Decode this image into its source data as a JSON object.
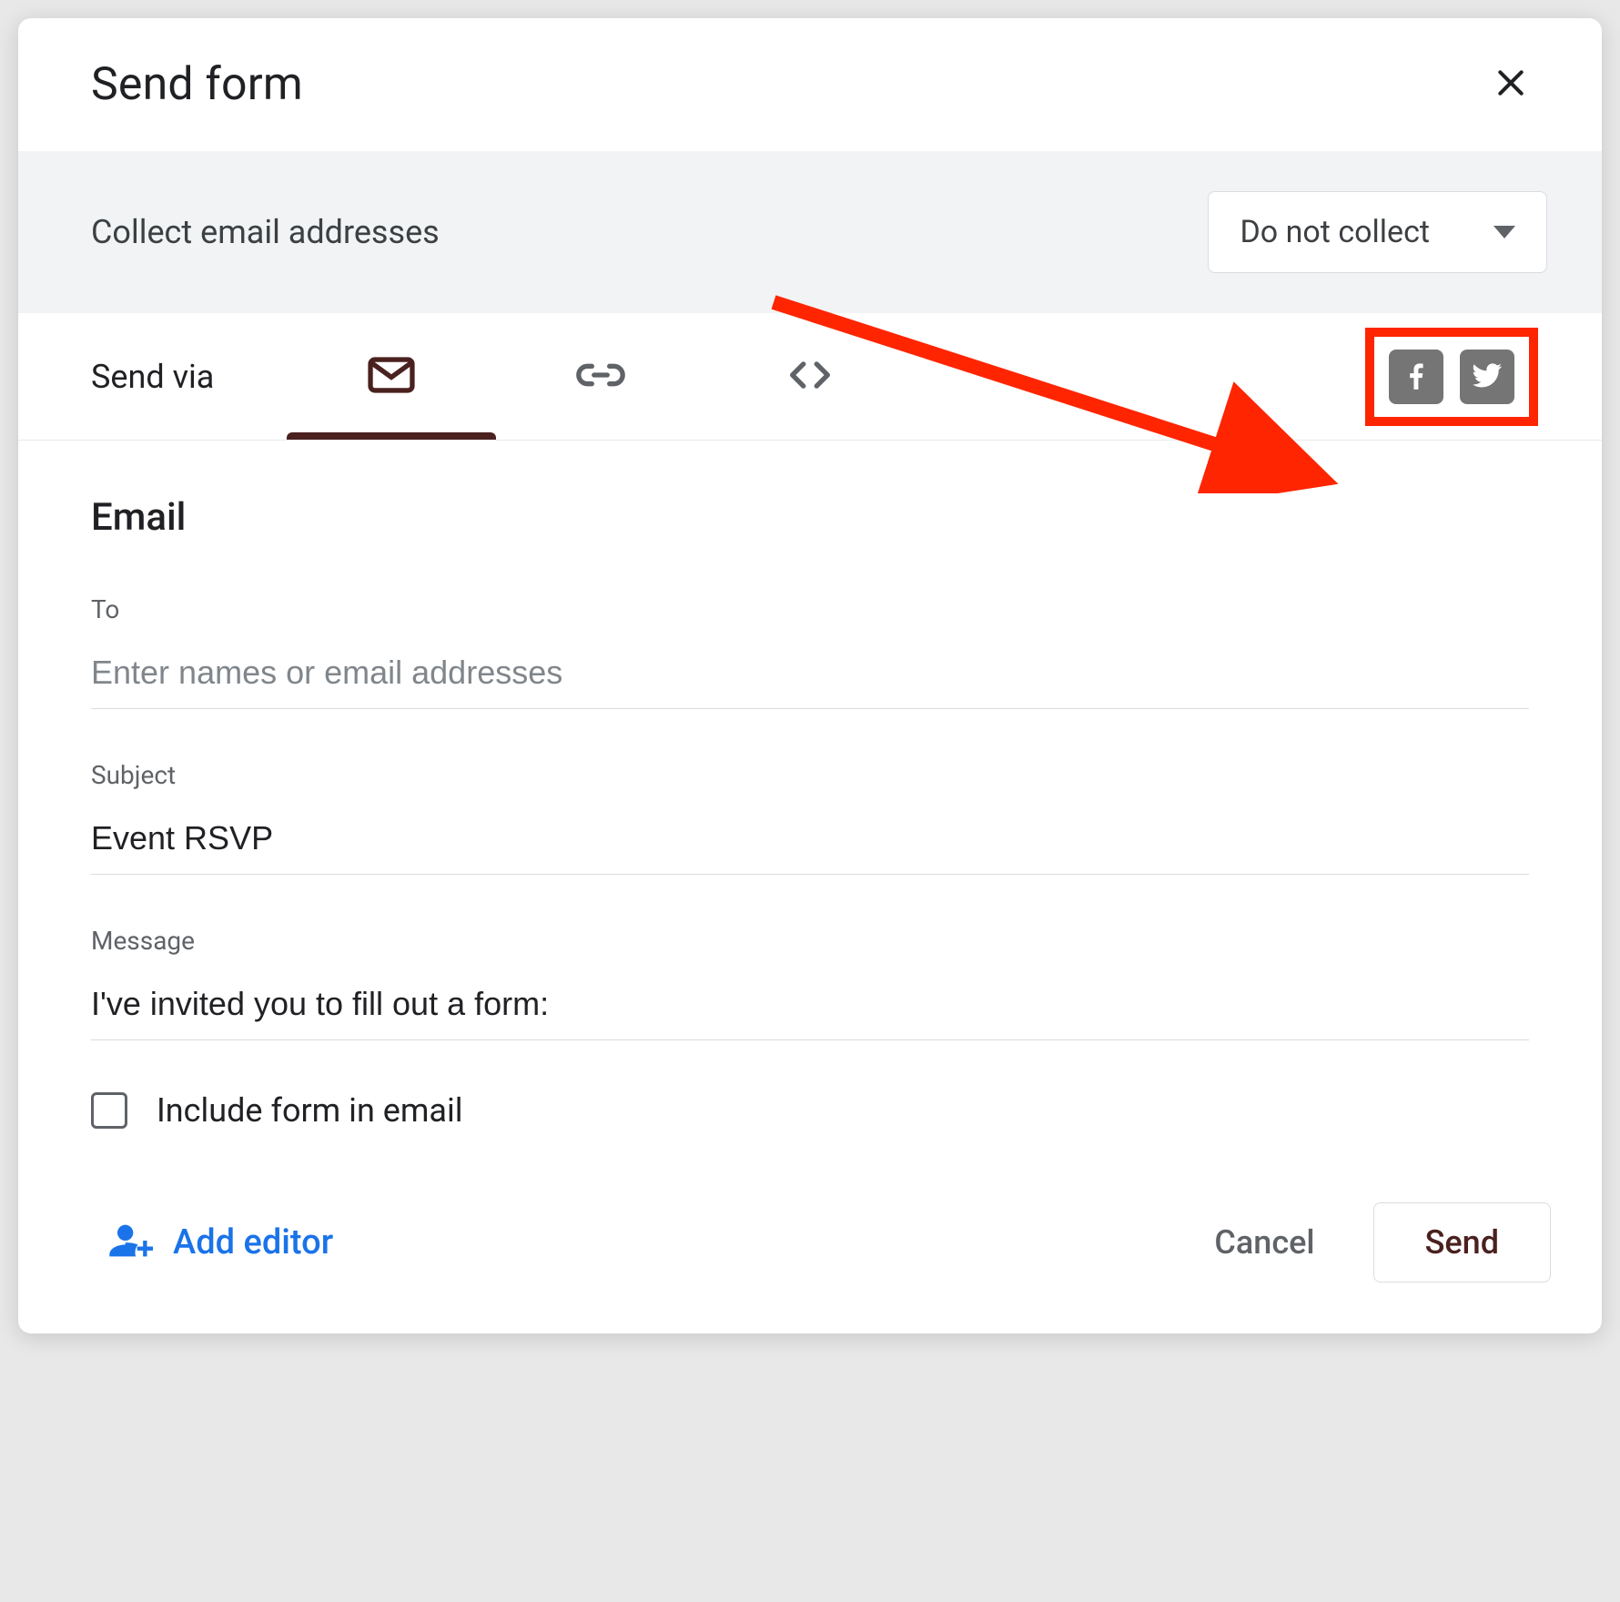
{
  "dialog": {
    "title": "Send form"
  },
  "collect": {
    "label": "Collect email addresses",
    "selected": "Do not collect"
  },
  "tabs": {
    "label": "Send via"
  },
  "section": {
    "title": "Email"
  },
  "fields": {
    "to_label": "To",
    "to_placeholder": "Enter names or email addresses",
    "to_value": "",
    "subject_label": "Subject",
    "subject_value": "Event RSVP",
    "message_label": "Message",
    "message_value": "I've invited you to fill out a form:"
  },
  "checkbox": {
    "label": "Include form in email",
    "checked": false
  },
  "footer": {
    "add_editor": "Add editor",
    "cancel": "Cancel",
    "send": "Send"
  },
  "annotation": {
    "color": "#fe2500"
  }
}
